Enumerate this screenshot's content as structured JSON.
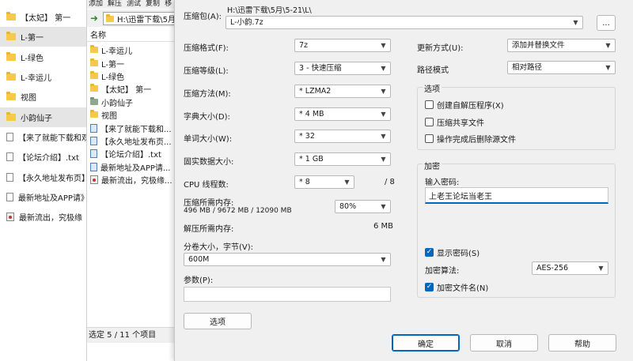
{
  "explorer": {
    "items": [
      {
        "label": "【太妃】 第一",
        "icon": "folder-icon"
      },
      {
        "label": "L-第一",
        "icon": "folder-icon"
      },
      {
        "label": "L-绿色",
        "icon": "folder-icon"
      },
      {
        "label": "L-幸运儿",
        "icon": "folder-icon"
      },
      {
        "label": "视图",
        "icon": "folder-icon"
      },
      {
        "label": "小韵仙子",
        "icon": "folder-icon"
      },
      {
        "label": "【来了就能下载和观",
        "icon": "document-icon"
      },
      {
        "label": "【论坛介绍】.txt",
        "icon": "document-icon"
      },
      {
        "label": "【永久地址发布页】.",
        "icon": "document-icon"
      },
      {
        "label": "最新地址及APP请》",
        "icon": "document-icon"
      },
      {
        "label": "最新流出，究极缘",
        "icon": "executable-icon"
      }
    ]
  },
  "zip": {
    "menu": [
      "添加",
      "解压",
      "测试",
      "复制",
      "移"
    ],
    "path": "H:\\迅雷下载\\5月",
    "column_name": "名称",
    "rows": [
      {
        "label": "L-幸运儿",
        "icon": "folder-icon"
      },
      {
        "label": "L-第一",
        "icon": "folder-icon"
      },
      {
        "label": "L-绿色",
        "icon": "folder-icon"
      },
      {
        "label": "【太妃】 第一",
        "icon": "folder-icon"
      },
      {
        "label": "小韵仙子",
        "icon": "folder-icon"
      },
      {
        "label": "视图",
        "icon": "folder-icon"
      },
      {
        "label": "【来了就能下载和...",
        "icon": "document-icon"
      },
      {
        "label": "【永久地址发布页...",
        "icon": "document-icon"
      },
      {
        "label": "【论坛介绍】.txt",
        "icon": "document-icon"
      },
      {
        "label": "最新地址及APP请...",
        "icon": "document-icon"
      },
      {
        "label": "最新流出，究极缘...",
        "icon": "executable-icon"
      }
    ],
    "status": "选定 5 / 11 个项目"
  },
  "dialog": {
    "archive_label": "压缩包(A):",
    "archive_dir": "H:\\迅雷下载\\5月\\5-21\\L\\",
    "archive_name": "L-小韵.7z",
    "browse_label": "...",
    "format_label": "压缩格式(F):",
    "format_value": "7z",
    "level_label": "压缩等级(L):",
    "level_value": "3 - 快速压缩",
    "method_label": "压缩方法(M):",
    "method_value": "* LZMA2",
    "dict_label": "字典大小(D):",
    "dict_value": "* 4 MB",
    "word_label": "单词大小(W):",
    "word_value": "* 32",
    "solid_label": "固实数据大小:",
    "solid_value": "* 1 GB",
    "cpu_label": "CPU 线程数:",
    "cpu_value": "* 8",
    "cpu_total": "/ 8",
    "mem_compress_label": "压缩所需内存:",
    "mem_compress_detail": "496 MB / 9672 MB / 12090 MB",
    "mem_percent": "80%",
    "mem_decompress_label": "解压所需内存:",
    "mem_decompress_value": "6 MB",
    "split_label": "分卷大小，字节(V):",
    "split_value": "600M",
    "params_label": "参数(P):",
    "params_value": "",
    "options_button": "选项",
    "update_label": "更新方式(U):",
    "update_value": "添加并替换文件",
    "pathmode_label": "路径模式",
    "pathmode_value": "相对路径",
    "options_group_label": "选项",
    "opt_sfx": "创建自解压程序(X)",
    "opt_shared": "压缩共享文件",
    "opt_delete": "操作完成后删除源文件",
    "encrypt_group_label": "加密",
    "password_label": "输入密码:",
    "password_value": "上老王论坛当老王",
    "show_password": "显示密码(S)",
    "enc_method_label": "加密算法:",
    "enc_method_value": "AES-256",
    "encrypt_names": "加密文件名(N)",
    "ok_button": "确定",
    "cancel_button": "取消",
    "help_button": "帮助"
  }
}
